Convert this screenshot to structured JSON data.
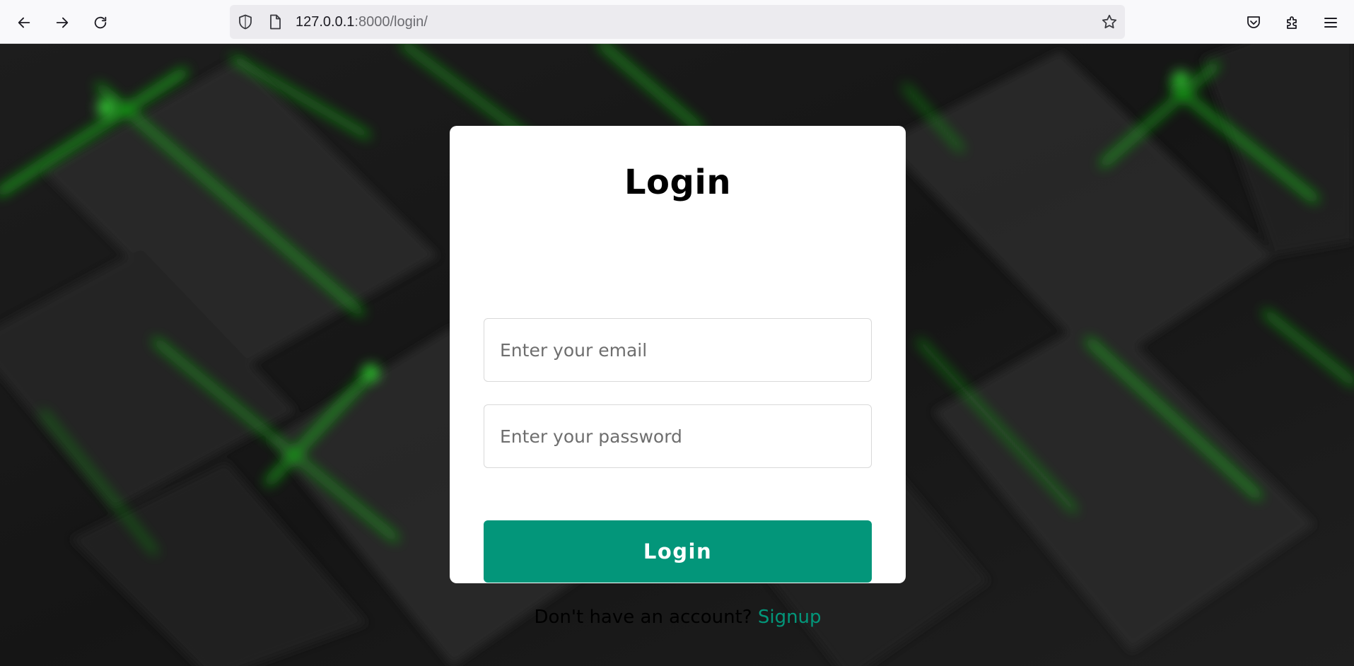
{
  "browser": {
    "url_host": "127.0.0.1",
    "url_rest": ":8000/login/"
  },
  "login": {
    "title": "Login",
    "email_placeholder": "Enter your email",
    "password_placeholder": "Enter your password",
    "button_label": "Login",
    "signup_prompt": "Don't have an account?",
    "signup_link": "Signup"
  },
  "colors": {
    "accent": "#03967a",
    "background_glow": "#1fd41f"
  },
  "icons": [
    "back-arrow-icon",
    "forward-arrow-icon",
    "reload-icon",
    "shield-icon",
    "page-icon",
    "star-icon",
    "pocket-icon",
    "extensions-icon",
    "menu-icon"
  ]
}
